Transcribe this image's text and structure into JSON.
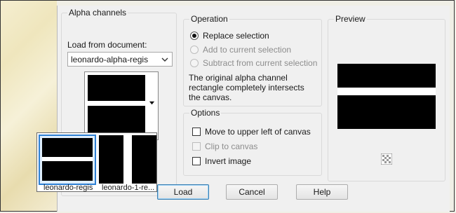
{
  "alpha_channels": {
    "title": "Alpha channels",
    "load_from_label": "Load from document:",
    "document_select": "leonardo-alpha-regis"
  },
  "operation": {
    "title": "Operation",
    "replace": "Replace selection",
    "add": "Add to current selection",
    "subtract": "Subtract from current selection",
    "info": "The original alpha channel rectangle completely intersects the canvas."
  },
  "options": {
    "title": "Options",
    "move": "Move to upper left of canvas",
    "clip": "Clip to canvas",
    "invert": "Invert image"
  },
  "preview": {
    "title": "Preview"
  },
  "popup": {
    "items": [
      {
        "label": "leonardo-regis"
      },
      {
        "label": "leonardo-1-re..."
      }
    ]
  },
  "buttons": {
    "load": "Load",
    "cancel": "Cancel",
    "help": "Help"
  },
  "icons": {
    "dropdown": "chevron-down-icon",
    "transparency": "checkerboard-icon"
  }
}
